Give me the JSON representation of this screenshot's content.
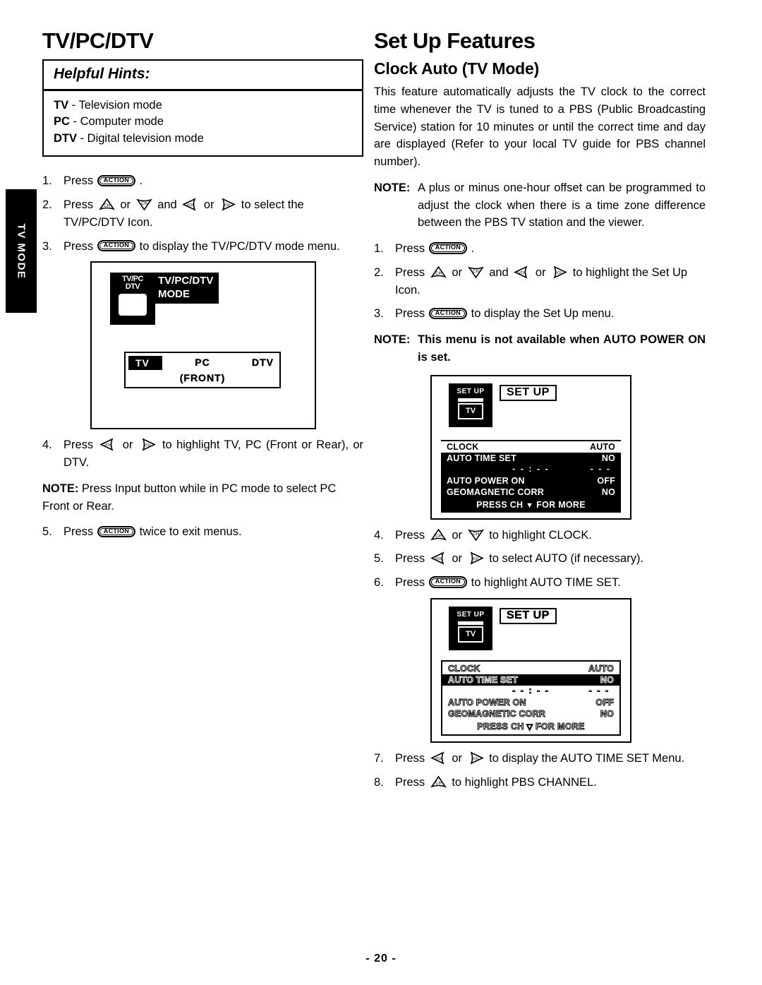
{
  "side_tab": {
    "label": "TV MODE"
  },
  "left_column": {
    "title": "TV/PC/DTV",
    "hints": {
      "heading": "Helpful Hints:",
      "lines": [
        {
          "term": "TV",
          "desc": " - Television mode"
        },
        {
          "term": "PC",
          "desc": " - Computer mode"
        },
        {
          "term": "DTV",
          "desc": " - Digital television mode"
        }
      ]
    },
    "steps": [
      {
        "num": "1.",
        "pre": "Press ",
        "key": "ACTION",
        "post": " ."
      },
      {
        "num": "2.",
        "pre": "Press ",
        "post": " to select the TV/PC/DTV Icon."
      },
      {
        "num": "3.",
        "pre": "Press ",
        "key": "ACTION",
        "post": " to display the TV/PC/DTV mode menu."
      },
      {
        "num": "4.",
        "pre": "Press ",
        "post": " to highlight TV, PC (Front or Rear), or DTV."
      },
      {
        "num": "5.",
        "pre": "Press ",
        "key": "ACTION",
        "post": " twice to exit menus."
      }
    ],
    "note": {
      "label": "NOTE:",
      "text": " Press Input button while in PC mode to select PC Front or Rear."
    },
    "illustration": {
      "icon_line1": "TV/PC",
      "icon_line2": "DTV",
      "mode_label_line1": "TV/PC/DTV",
      "mode_label_line2": "MODE",
      "options": {
        "tv": "TV",
        "pc": "PC",
        "dtv": "DTV",
        "front": "(FRONT)"
      }
    }
  },
  "right_column": {
    "title": "Set Up Features",
    "subtitle": "Clock Auto (TV Mode)",
    "paragraph": "This feature automatically adjusts the TV clock to the correct time whenever the TV is tuned to a PBS (Public Broadcasting Service) station for 10 minutes or until the correct time and day are displayed (Refer to your local TV guide for PBS channel number).",
    "note1": {
      "label": "NOTE:",
      "text": "A plus or minus one-hour offset can be programmed to adjust the clock when there is a time zone difference between the PBS TV station and the viewer."
    },
    "note2": {
      "label": "NOTE:",
      "text": "This menu is not available when AUTO POWER ON is set."
    },
    "steps": [
      {
        "num": "1.",
        "pre": "Press ",
        "key": "ACTION",
        "post": " ."
      },
      {
        "num": "2.",
        "pre": "Press ",
        "post": " to highlight the Set Up Icon."
      },
      {
        "num": "3.",
        "pre": "Press ",
        "key": "ACTION",
        "post": " to display the Set Up menu."
      },
      {
        "num": "4.",
        "pre": "Press ",
        "post": " to highlight CLOCK."
      },
      {
        "num": "5.",
        "pre": "Press ",
        "post": " to select AUTO (if necessary)."
      },
      {
        "num": "6.",
        "pre": "Press ",
        "key": "ACTION",
        "post": " to highlight AUTO TIME SET."
      },
      {
        "num": "7.",
        "pre": "Press ",
        "post": " to display the AUTO TIME SET Menu."
      },
      {
        "num": "8.",
        "pre": "Press ",
        "post": " to highlight PBS CHANNEL."
      }
    ],
    "setup_menu_1": {
      "icon_label": "SET UP",
      "icon_box_label": "TV",
      "title": "SET UP",
      "rows": [
        {
          "label": "CLOCK",
          "value": "AUTO",
          "highlighted": true
        },
        {
          "label": "AUTO TIME SET",
          "value": "NO",
          "highlighted": false
        }
      ],
      "time_row": {
        "time": "- - : - -",
        "day": "- - -"
      },
      "rows2": [
        {
          "label": "AUTO POWER ON",
          "value": "OFF",
          "highlighted": false
        },
        {
          "label": "GEOMAGNETIC CORR",
          "value": "NO",
          "highlighted": false
        }
      ],
      "footer_pre": "PRESS CH",
      "footer_caret": "▼",
      "footer_post": "FOR MORE"
    },
    "setup_menu_2": {
      "icon_label": "SET UP",
      "icon_box_label": "TV",
      "title": "SET UP",
      "rows": [
        {
          "label": "CLOCK",
          "value": "AUTO",
          "highlighted": false
        },
        {
          "label": "AUTO TIME SET",
          "value": "NO",
          "highlighted": true
        }
      ],
      "time_row": {
        "time": "- - : - -",
        "day": "- - -"
      },
      "rows2": [
        {
          "label": "AUTO POWER ON",
          "value": "OFF",
          "highlighted": false
        },
        {
          "label": "GEOMAGNETIC CORR",
          "value": "NO",
          "highlighted": false
        }
      ],
      "footer_pre": "PRESS CH",
      "footer_caret": "▽",
      "footer_post": "FOR MORE"
    }
  },
  "footer": {
    "page_number": "- 20 -"
  }
}
